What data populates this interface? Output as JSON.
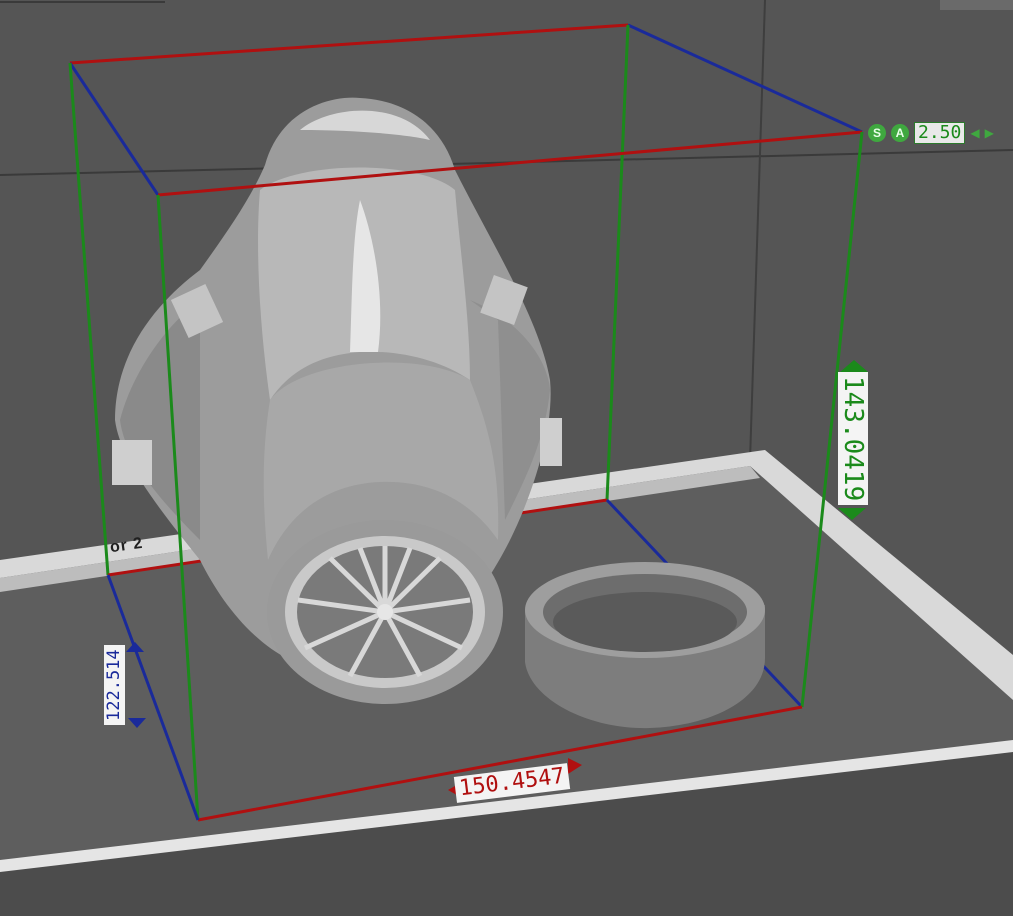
{
  "hud": {
    "snap_label": "S",
    "angle_label": "A",
    "step_value": "2.50"
  },
  "dimensions": {
    "width": "150.4547",
    "depth": "122.514",
    "height": "143.0419"
  },
  "floor_label": "or 2",
  "colors": {
    "x_axis": "#b01010",
    "y_axis": "#1a2a9a",
    "z_axis": "#1b8a1b",
    "hud_accent": "#3fa83f"
  }
}
